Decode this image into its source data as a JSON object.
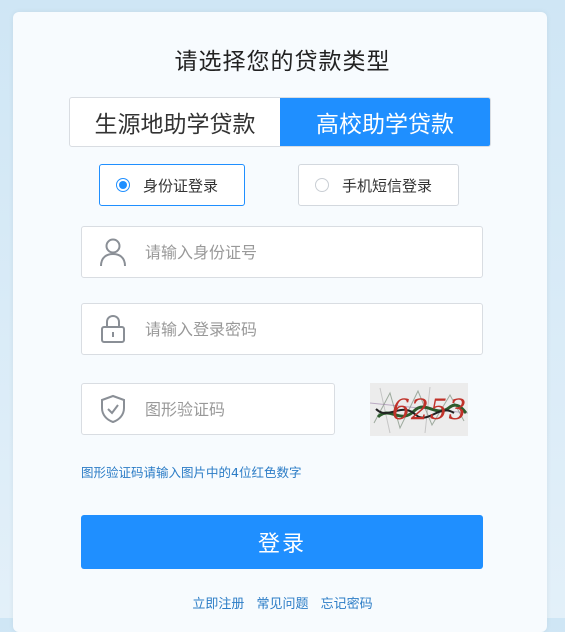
{
  "heading": "请选择您的贷款类型",
  "loan_tabs": [
    {
      "label": "生源地助学贷款",
      "active": false
    },
    {
      "label": "高校助学贷款",
      "active": true
    }
  ],
  "login_modes": [
    {
      "label": "身份证登录",
      "active": true
    },
    {
      "label": "手机短信登录",
      "active": false
    }
  ],
  "fields": {
    "id_number": {
      "placeholder": "请输入身份证号",
      "value": ""
    },
    "password": {
      "placeholder": "请输入登录密码",
      "value": ""
    },
    "captcha": {
      "placeholder": "图形验证码",
      "value": ""
    }
  },
  "captcha_image": {
    "text": "6253",
    "icon": "captcha-image"
  },
  "hint": "图形验证码请输入图片中的4位红色数字",
  "submit_label": "登录",
  "footer_links": [
    "立即注册",
    "常见问题",
    "忘记密码"
  ],
  "colors": {
    "accent": "#1f8fff",
    "link": "#2b7cc6"
  }
}
